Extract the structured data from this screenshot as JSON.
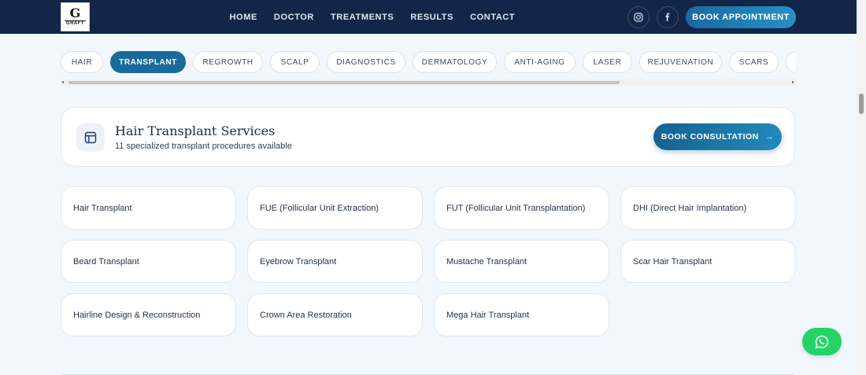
{
  "brand": {
    "logo_letter": "G",
    "logo_text": "GRAFT"
  },
  "nav": {
    "links": [
      "HOME",
      "DOCTOR",
      "TREATMENTS",
      "RESULTS",
      "CONTACT"
    ],
    "book_label": "BOOK APPOINTMENT",
    "social_icons": [
      "instagram-icon",
      "facebook-icon"
    ]
  },
  "tabs": {
    "items": [
      "HAIR",
      "TRANSPLANT",
      "REGROWTH",
      "SCALP",
      "DIAGNOSTICS",
      "DERMATOLOGY",
      "ANTI-AGING",
      "LASER",
      "REJUVENATION",
      "SCARS",
      ""
    ],
    "active": "TRANSPLANT"
  },
  "section": {
    "icon": "layout-icon",
    "title": "Hair Transplant Services",
    "subtitle": "11 specialized transplant procedures available",
    "cta_label": "BOOK CONSULTATION",
    "cta_arrow": "→"
  },
  "procedures": [
    "Hair Transplant",
    "FUE (Follicular Unit Extraction)",
    "FUT (Follicular Unit Transplantation)",
    "DHI (Direct Hair Implantation)",
    "Beard Transplant",
    "Eyebrow Transplant",
    "Mustache Transplant",
    "Scar Hair Transplant",
    "Hairline Design & Reconstruction",
    "Crown Area Restoration",
    "Mega Hair Transplant"
  ],
  "colors": {
    "header_bg": "#14254a",
    "accent": "#1b6a9c",
    "whatsapp": "#25d366"
  }
}
